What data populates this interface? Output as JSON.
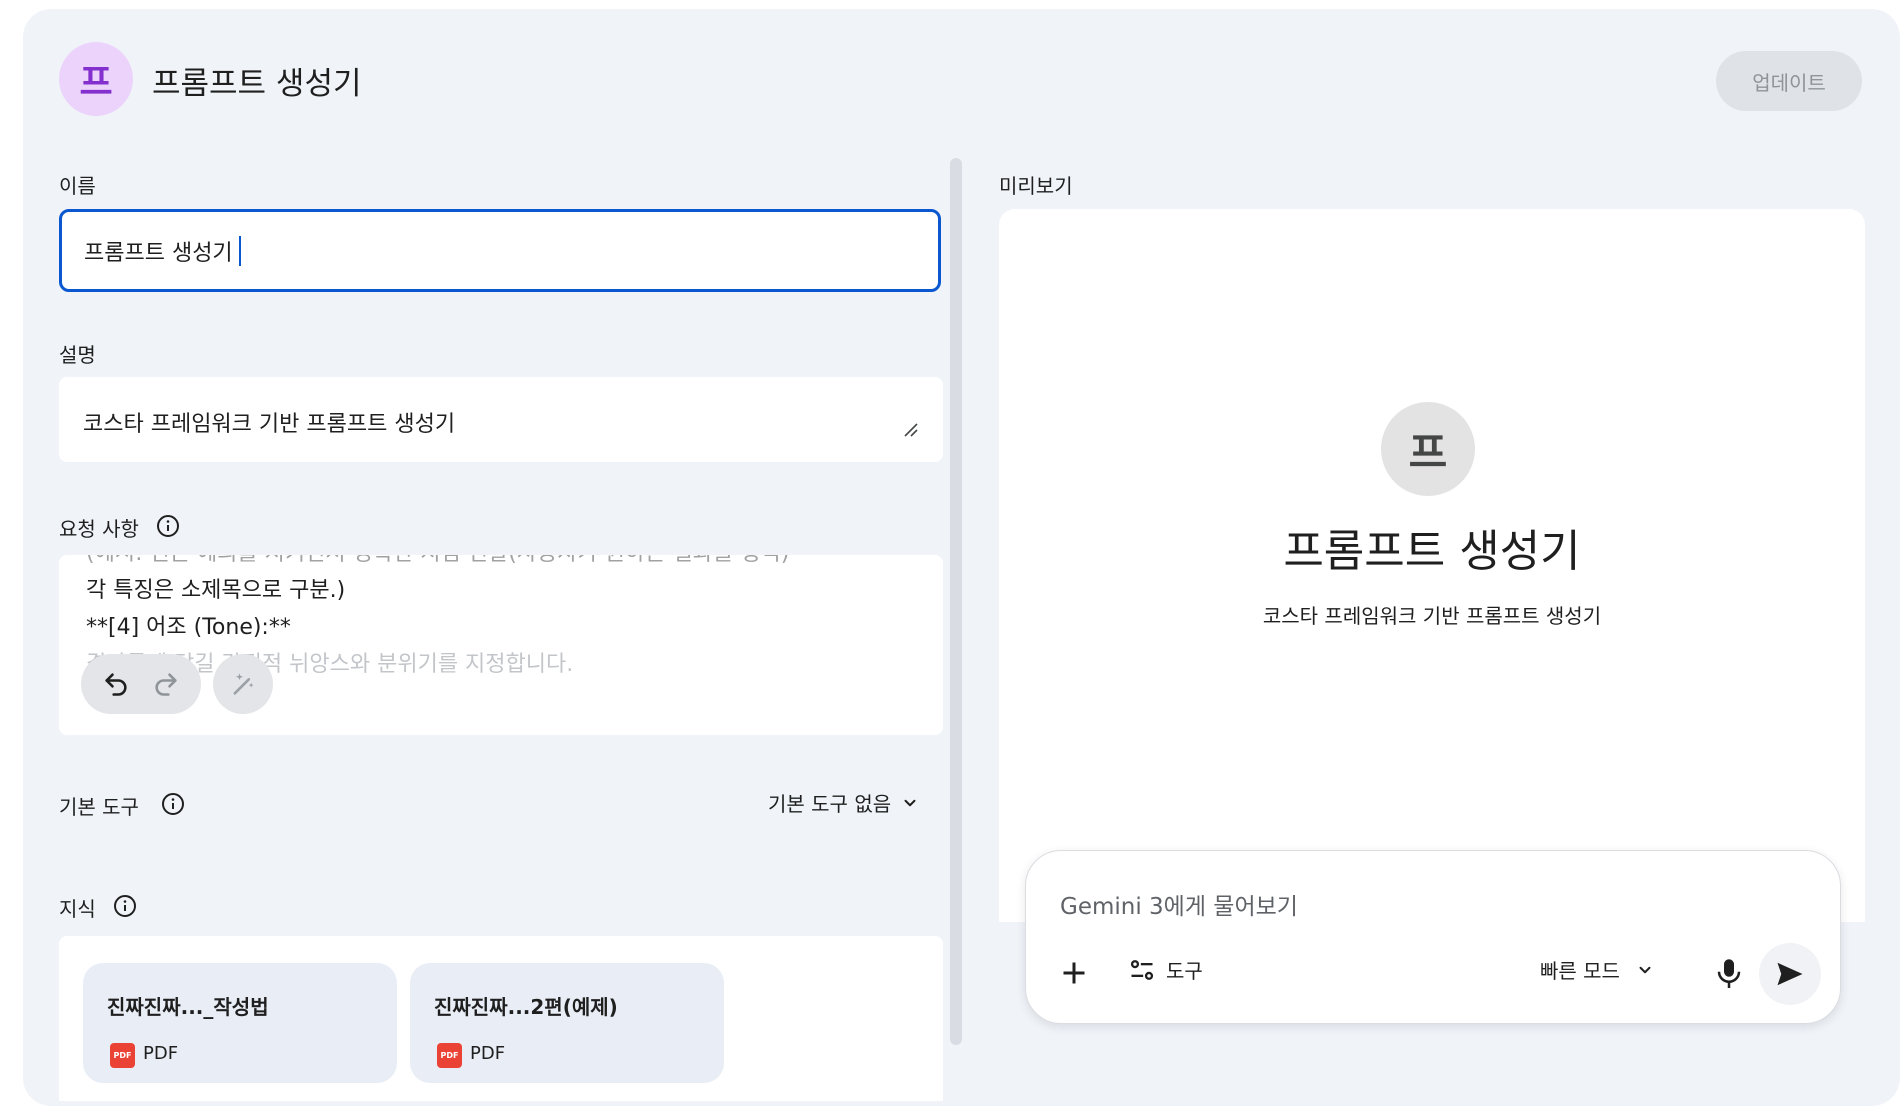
{
  "header": {
    "avatar_letter": "프",
    "title": "프롬프트 생성기",
    "update_label": "업데이트"
  },
  "form": {
    "name_label": "이름",
    "name_value": "프롬프트 생성기",
    "description_label": "설명",
    "description_value": "코스타 프레임워크 기반 프롬프트 생성기",
    "instructions_label": "요청 사항",
    "instructions_lines": [
      "(에시: 친근·예의를 지키면서 명확한 지침 전달(사용자가 원하는 결과물 형식)",
      "각 특징은 소제목으로 구분.)",
      "**[4] 어조 (Tone):**",
      "결과물에 담길 감정적 뉘앙스와 분위기를 지정합니다."
    ],
    "default_tools_label": "기본 도구",
    "default_tools_value": "기본 도구 없음",
    "knowledge_label": "지식",
    "files": [
      {
        "name": "진짜진짜..._작성법",
        "type": "PDF"
      },
      {
        "name": "진짜진짜...2편(예제)",
        "type": "PDF"
      }
    ]
  },
  "preview": {
    "label": "미리보기",
    "avatar_letter": "프",
    "title": "프롬프트 생성기",
    "description": "코스타 프레임워크 기반 프롬프트 생성기",
    "chat_placeholder": "Gemini 3에게 물어보기",
    "tools_label": "도구",
    "mode_label": "빠른 모드"
  },
  "colors": {
    "accent": "#0b57d0",
    "avatar_bg": "#ecd3fb",
    "avatar_fg": "#8430ce",
    "card_bg": "#f0f4f9",
    "pdf_red": "#ea4335"
  },
  "icons": [
    "info-icon",
    "undo-icon",
    "redo-icon",
    "magic-wand-icon",
    "chevron-down-icon",
    "plus-icon",
    "tools-icon",
    "mic-icon",
    "send-icon",
    "pdf-icon",
    "resize-handle-icon"
  ]
}
